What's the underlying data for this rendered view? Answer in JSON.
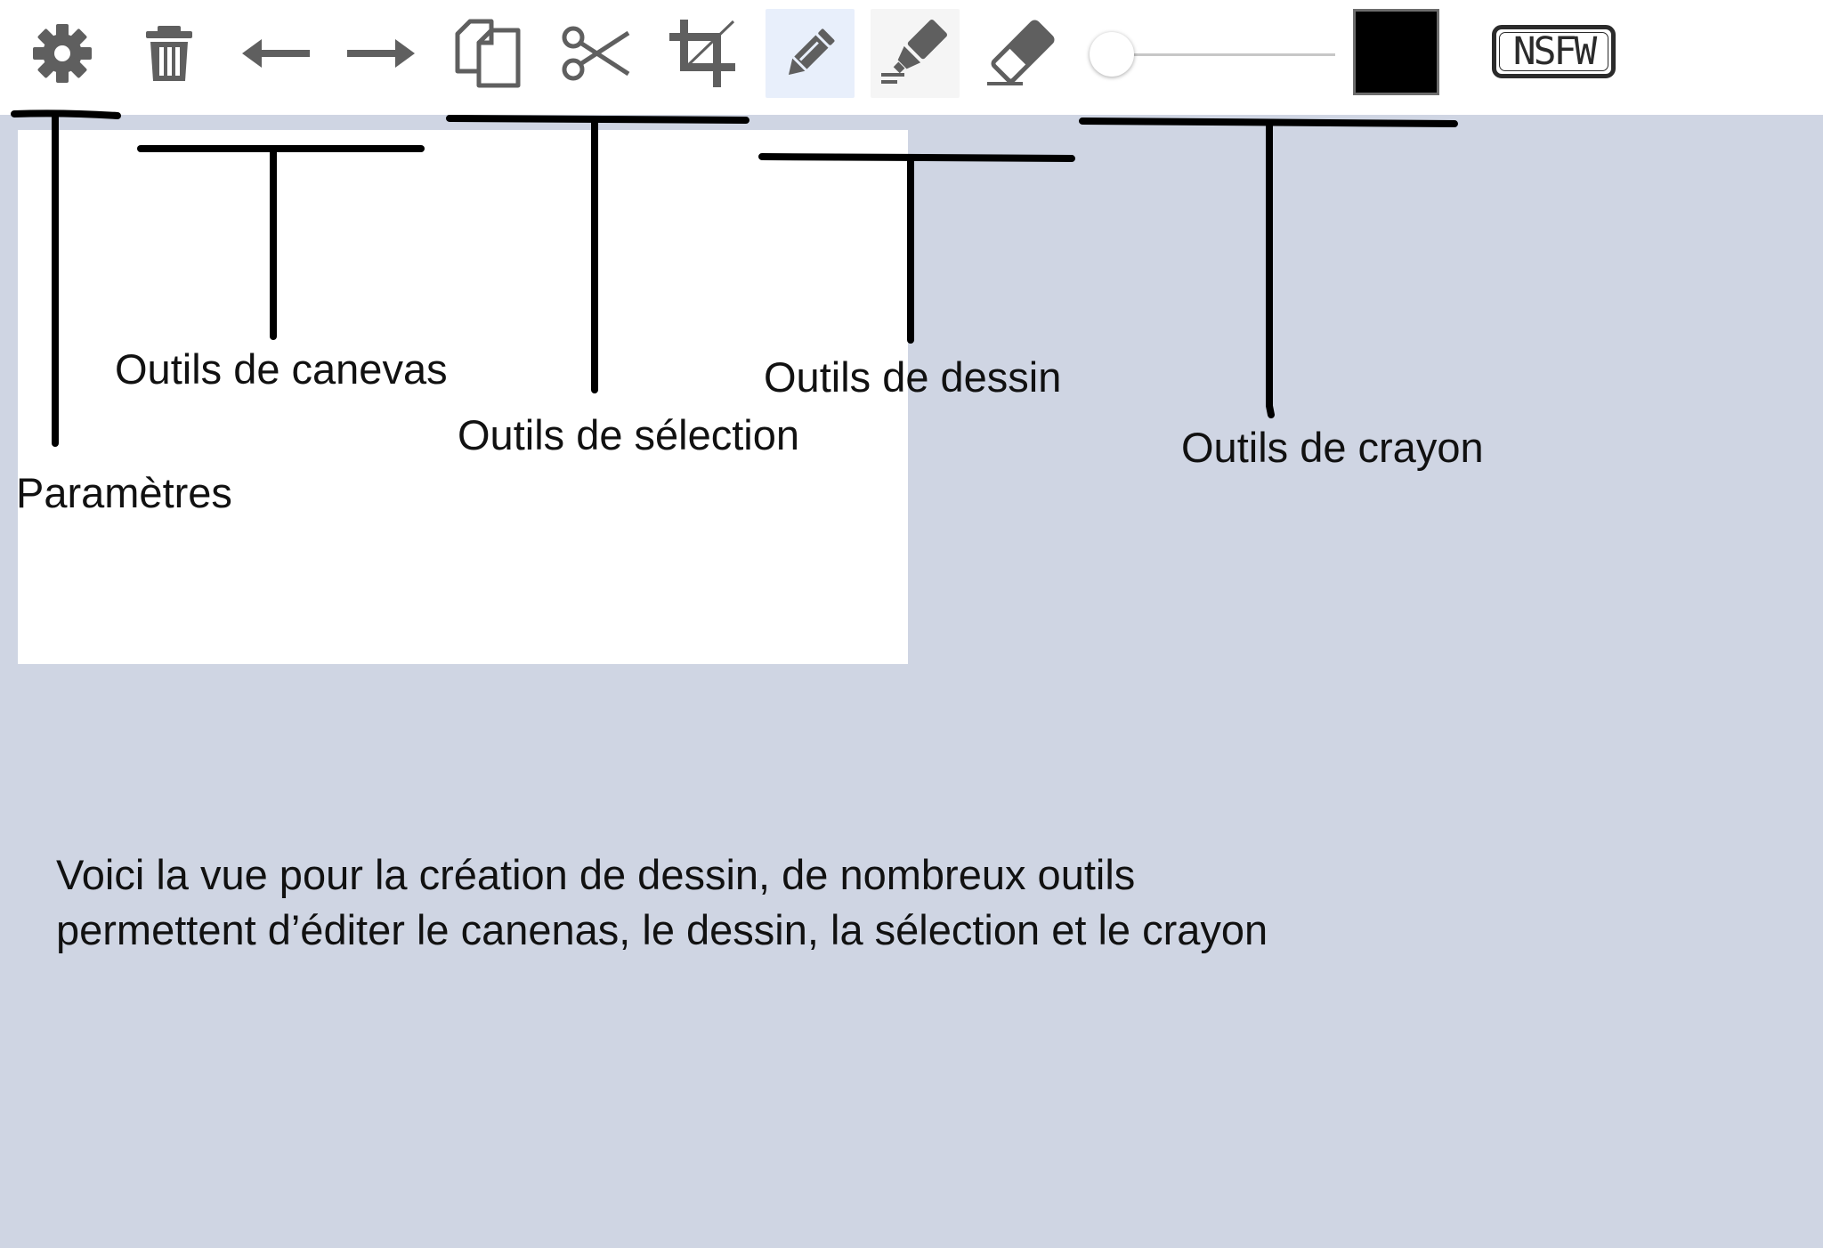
{
  "toolbar": {
    "tools": [
      {
        "icon": "gear-icon",
        "tooltip": "Paramètres"
      },
      {
        "icon": "trash-icon"
      },
      {
        "icon": "undo-arrow-icon"
      },
      {
        "icon": "redo-arrow-icon"
      },
      {
        "icon": "copy-icon"
      },
      {
        "icon": "scissors-icon"
      },
      {
        "icon": "crop-icon"
      },
      {
        "icon": "pencil-icon",
        "state": "active"
      },
      {
        "icon": "marker-icon",
        "state": "hover"
      },
      {
        "icon": "eraser-icon"
      }
    ],
    "brush_size": 0,
    "color": "#000000",
    "nsfw_label": "NSFW"
  },
  "annotations": {
    "settings": "Paramètres",
    "canvas_tools": "Outils de canevas",
    "selection_tools": "Outils de sélection",
    "drawing_tools": "Outils de dessin",
    "pencil_tools": "Outils de crayon"
  },
  "caption": {
    "line1": "Voici la vue pour la création de dessin, de nombreux outils",
    "line2": "permettent d’éditer le canenas, le dessin, la sélection et le crayon"
  },
  "colors": {
    "background": "#cfd5e3",
    "toolbar": "#ffffff",
    "icon": "#5f5f5f",
    "active_tool_bg": "#e8effb",
    "annotation_ink": "#000000"
  }
}
